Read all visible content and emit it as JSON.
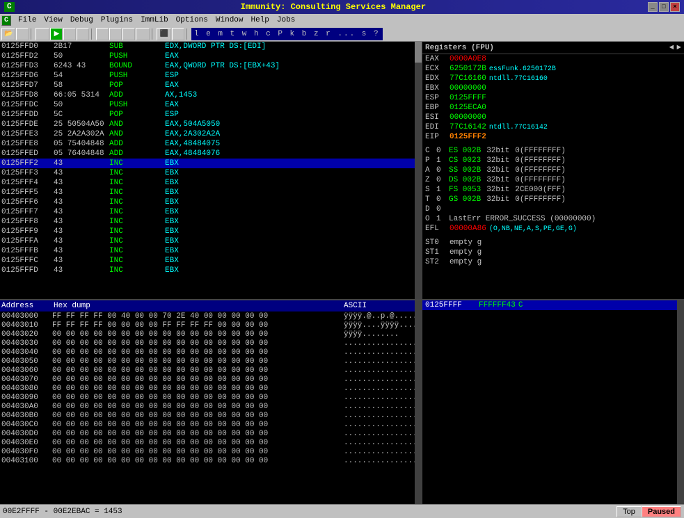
{
  "titlebar": {
    "left": "C",
    "title": "Immunity: Consulting Services Manager",
    "controls": [
      "_",
      "□",
      "×"
    ]
  },
  "menubar": {
    "items": [
      "File",
      "View",
      "Debug",
      "Plugins",
      "ImmLib",
      "Options",
      "Window",
      "Help",
      "Jobs"
    ]
  },
  "toolbar": {
    "cmd_letters": "l e m t w h c P k b z r ... s ?"
  },
  "disasm": {
    "rows": [
      {
        "addr": "0125FFD0",
        "bytes": "2B17",
        "mnem": "SUB",
        "ops": "EDX,DWORD PTR DS:[EDI]",
        "selected": false
      },
      {
        "addr": "0125FFD2",
        "bytes": "50",
        "mnem": "PUSH",
        "ops": "EAX",
        "selected": false
      },
      {
        "addr": "0125FFD3",
        "bytes": "6243 43",
        "mnem": "BOUND",
        "ops": "EAX,QWORD PTR DS:[EBX+43]",
        "selected": false
      },
      {
        "addr": "0125FFD6",
        "bytes": "54",
        "mnem": "PUSH",
        "ops": "ESP",
        "selected": false
      },
      {
        "addr": "0125FFD7",
        "bytes": "58",
        "mnem": "POP",
        "ops": "EAX",
        "selected": false
      },
      {
        "addr": "0125FFD8",
        "bytes": "66:05 5314",
        "mnem": "ADD",
        "ops": "AX,1453",
        "selected": false
      },
      {
        "addr": "0125FFDC",
        "bytes": "50",
        "mnem": "PUSH",
        "ops": "EAX",
        "selected": false
      },
      {
        "addr": "0125FFDD",
        "bytes": "5C",
        "mnem": "POP",
        "ops": "ESP",
        "selected": false
      },
      {
        "addr": "0125FFDE",
        "bytes": "25 50504A50",
        "mnem": "AND",
        "ops": "EAX,504A5050",
        "selected": false
      },
      {
        "addr": "0125FFE3",
        "bytes": "25 2A2A302A",
        "mnem": "AND",
        "ops": "EAX,2A302A2A",
        "selected": false
      },
      {
        "addr": "0125FFE8",
        "bytes": "05 75404848",
        "mnem": "ADD",
        "ops": "EAX,48484075",
        "selected": false
      },
      {
        "addr": "0125FFED",
        "bytes": "05 76404848",
        "mnem": "ADD",
        "ops": "EAX,48484076",
        "selected": false
      },
      {
        "addr": "0125FFF2",
        "bytes": "43",
        "mnem": "INC",
        "ops": "EBX",
        "selected": true
      },
      {
        "addr": "0125FFF3",
        "bytes": "43",
        "mnem": "INC",
        "ops": "EBX",
        "selected": false
      },
      {
        "addr": "0125FFF4",
        "bytes": "43",
        "mnem": "INC",
        "ops": "EBX",
        "selected": false
      },
      {
        "addr": "0125FFF5",
        "bytes": "43",
        "mnem": "INC",
        "ops": "EBX",
        "selected": false
      },
      {
        "addr": "0125FFF6",
        "bytes": "43",
        "mnem": "INC",
        "ops": "EBX",
        "selected": false
      },
      {
        "addr": "0125FFF7",
        "bytes": "43",
        "mnem": "INC",
        "ops": "EBX",
        "selected": false
      },
      {
        "addr": "0125FFF8",
        "bytes": "43",
        "mnem": "INC",
        "ops": "EBX",
        "selected": false
      },
      {
        "addr": "0125FFF9",
        "bytes": "43",
        "mnem": "INC",
        "ops": "EBX",
        "selected": false
      },
      {
        "addr": "0125FFFA",
        "bytes": "43",
        "mnem": "INC",
        "ops": "EBX",
        "selected": false
      },
      {
        "addr": "0125FFFB",
        "bytes": "43",
        "mnem": "INC",
        "ops": "EBX",
        "selected": false
      },
      {
        "addr": "0125FFFC",
        "bytes": "43",
        "mnem": "INC",
        "ops": "EBX",
        "selected": false
      },
      {
        "addr": "0125FFFD",
        "bytes": "43",
        "mnem": "INC",
        "ops": "EBX",
        "selected": false
      }
    ]
  },
  "registers": {
    "title": "Registers (FPU)",
    "gpr": [
      {
        "name": "EAX",
        "value": "0000A0E8",
        "comment": "",
        "highlight": true
      },
      {
        "name": "ECX",
        "value": "6250172B",
        "comment": "essFunk.6250172B"
      },
      {
        "name": "EDX",
        "value": "77C16160",
        "comment": "ntdll.77C16160"
      },
      {
        "name": "EBX",
        "value": "00000000",
        "comment": ""
      },
      {
        "name": "ESP",
        "value": "0125FFFF",
        "comment": ""
      },
      {
        "name": "EBP",
        "value": "0125ECA0",
        "comment": ""
      },
      {
        "name": "ESI",
        "value": "00000000",
        "comment": ""
      },
      {
        "name": "EDI",
        "value": "77C16142",
        "comment": "ntdll.77C16142"
      }
    ],
    "eip": {
      "name": "EIP",
      "value": "0125FFF2"
    },
    "flags": [
      {
        "flag": "C",
        "val": "0",
        "seg": "ES",
        "segnum": "002B",
        "bits": "32bit",
        "mask": "0(FFFFFFFF)"
      },
      {
        "flag": "P",
        "val": "1",
        "seg": "CS",
        "segnum": "0023",
        "bits": "32bit",
        "mask": "0(FFFFFFFF)"
      },
      {
        "flag": "A",
        "val": "0",
        "seg": "SS",
        "segnum": "002B",
        "bits": "32bit",
        "mask": "0(FFFFFFFF)"
      },
      {
        "flag": "Z",
        "val": "0",
        "seg": "DS",
        "segnum": "002B",
        "bits": "32bit",
        "mask": "0(FFFFFFFF)"
      },
      {
        "flag": "S",
        "val": "1",
        "seg": "FS",
        "segnum": "0053",
        "bits": "32bit",
        "mask": "2CE000(FFF)"
      },
      {
        "flag": "T",
        "val": "0",
        "seg": "GS",
        "segnum": "002B",
        "bits": "32bit",
        "mask": "0(FFFFFFFF)"
      },
      {
        "flag": "D",
        "val": "0",
        "seg": "",
        "segnum": "",
        "bits": "",
        "mask": ""
      },
      {
        "flag": "O",
        "val": "1",
        "seg": "",
        "segnum": "",
        "bits": "LastErr",
        "mask": "ERROR_SUCCESS (00000000)"
      }
    ],
    "efl": {
      "value": "00000A86",
      "comment": "(O,NB,NE,A,S,PE,GE,G)"
    },
    "st": [
      {
        "name": "ST0",
        "value": "empty g"
      },
      {
        "name": "ST1",
        "value": "empty g"
      },
      {
        "name": "ST2",
        "value": "empty g"
      }
    ]
  },
  "hex": {
    "header": {
      "address": "Address",
      "hex": "Hex dump",
      "ascii": "ASCII"
    },
    "rows": [
      {
        "addr": "00403000",
        "bytes": "FF FF FF FF  00 40 00 00  70 2E 40 00  00 00 00 00",
        "ascii": "ÿÿÿÿ.@..p.@....."
      },
      {
        "addr": "00403010",
        "bytes": "FF FF FF FF  00 00 00 00  FF FF FF FF  00 00 00 00",
        "ascii": "ÿÿÿÿ....ÿÿÿÿ...."
      },
      {
        "addr": "00403020",
        "bytes": "00 00 00 00  00 00 00 00  00 00 00 00  00 00 00 00",
        "ascii": "ÿÿÿÿ........"
      },
      {
        "addr": "00403030",
        "bytes": "00 00 00 00  00 00 00 00  00 00 00 00  00 00 00 00",
        "ascii": "................"
      },
      {
        "addr": "00403040",
        "bytes": "00 00 00 00  00 00 00 00  00 00 00 00  00 00 00 00",
        "ascii": "................"
      },
      {
        "addr": "00403050",
        "bytes": "00 00 00 00  00 00 00 00  00 00 00 00  00 00 00 00",
        "ascii": "................"
      },
      {
        "addr": "00403060",
        "bytes": "00 00 00 00  00 00 00 00  00 00 00 00  00 00 00 00",
        "ascii": "................"
      },
      {
        "addr": "00403070",
        "bytes": "00 00 00 00  00 00 00 00  00 00 00 00  00 00 00 00",
        "ascii": "................"
      },
      {
        "addr": "00403080",
        "bytes": "00 00 00 00  00 00 00 00  00 00 00 00  00 00 00 00",
        "ascii": "................"
      },
      {
        "addr": "00403090",
        "bytes": "00 00 00 00  00 00 00 00  00 00 00 00  00 00 00 00",
        "ascii": "................"
      },
      {
        "addr": "004030A0",
        "bytes": "00 00 00 00  00 00 00 00  00 00 00 00  00 00 00 00",
        "ascii": "................"
      },
      {
        "addr": "004030B0",
        "bytes": "00 00 00 00  00 00 00 00  00 00 00 00  00 00 00 00",
        "ascii": "................"
      },
      {
        "addr": "004030C0",
        "bytes": "00 00 00 00  00 00 00 00  00 00 00 00  00 00 00 00",
        "ascii": "................"
      },
      {
        "addr": "004030D0",
        "bytes": "00 00 00 00  00 00 00 00  00 00 00 00  00 00 00 00",
        "ascii": "................"
      },
      {
        "addr": "004030E0",
        "bytes": "00 00 00 00  00 00 00 00  00 00 00 00  00 00 00 00",
        "ascii": "................"
      },
      {
        "addr": "004030F0",
        "bytes": "00 00 00 00  00 00 00 00  00 00 00 00  00 00 00 00",
        "ascii": "................"
      },
      {
        "addr": "00403100",
        "bytes": "00 00 00 00  00 00 00 00  00 00 00 00  00 00 00 00",
        "ascii": "................"
      }
    ]
  },
  "reg_dump": {
    "rows": [
      {
        "addr": "0125FFFF",
        "val": "FFFFFF43",
        "ascii": "C",
        "selected": true
      }
    ]
  },
  "statusbar": {
    "left": "00E2FFFF - 00E2EBAC = 1453",
    "top_btn": "Top",
    "paused_btn": "Paused"
  }
}
